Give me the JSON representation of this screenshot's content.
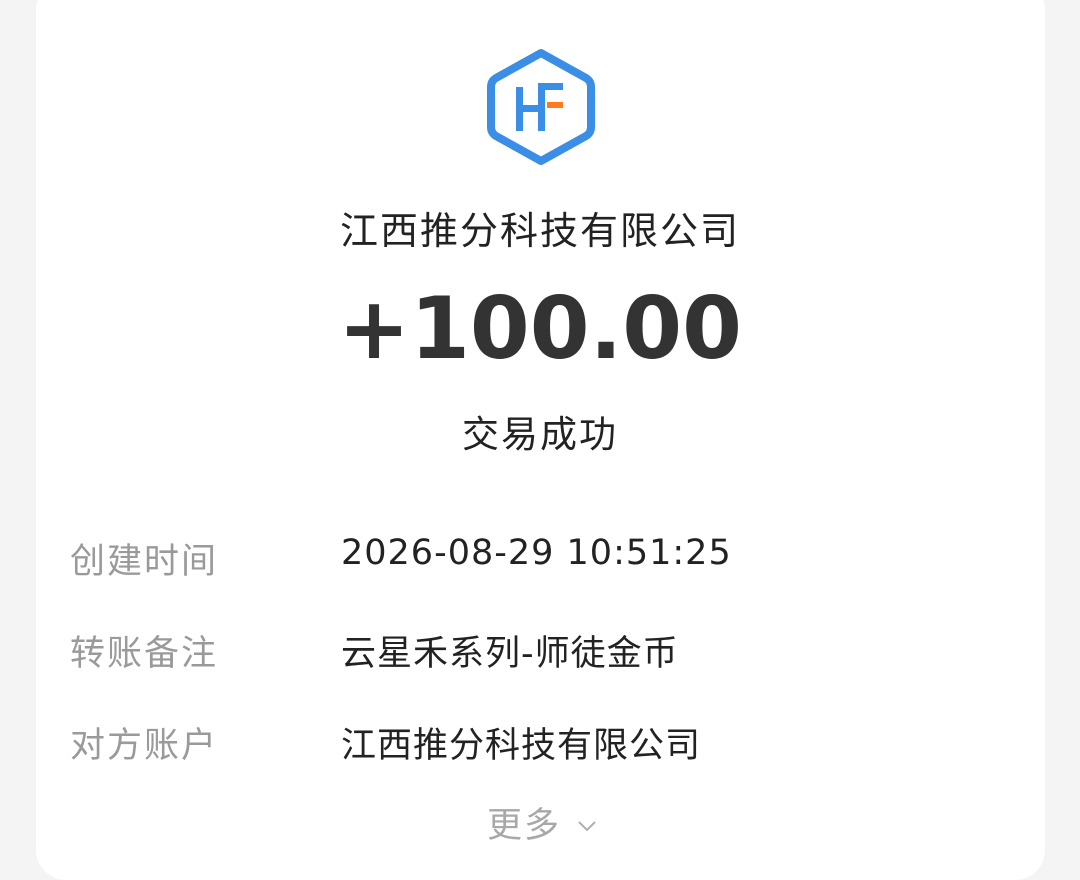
{
  "merchant": {
    "name": "江西推分科技有限公司"
  },
  "transaction": {
    "amount": "+100.00",
    "status": "交易成功"
  },
  "details": [
    {
      "label": "创建时间",
      "value": "2026-08-29 10:51:25"
    },
    {
      "label": "转账备注",
      "value": "云星禾系列-师徒金币"
    },
    {
      "label": "对方账户",
      "value": "江西推分科技有限公司"
    }
  ],
  "more": {
    "label": "更多",
    "icon": "chevron-down-icon"
  },
  "colors": {
    "logo_blue": "#3a8ee6",
    "logo_orange": "#ff7a1a",
    "label_gray": "#9a9a9a",
    "text_dark": "#222222"
  }
}
